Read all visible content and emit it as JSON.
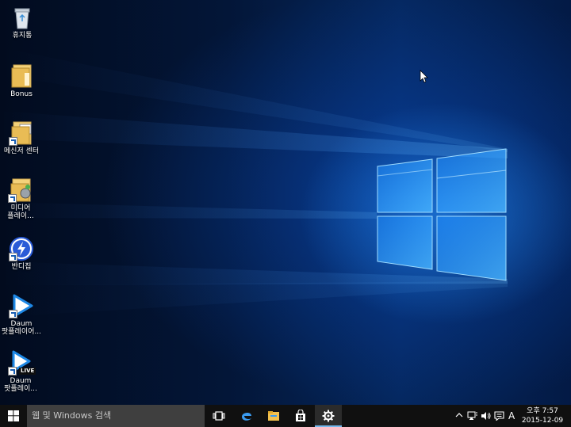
{
  "desktop": {
    "icons": [
      {
        "label": "휴지통"
      },
      {
        "label": "Bonus"
      },
      {
        "label": "메신저 센터"
      },
      {
        "label_line1": "미디어",
        "label_line2": "플레이..."
      },
      {
        "label": "반디집"
      },
      {
        "label_line1": "Daum",
        "label_line2": "팟플레이어..."
      },
      {
        "label_line1": "Daum",
        "label_line2": "팟플레이...",
        "badge": "LIVE"
      }
    ]
  },
  "taskbar": {
    "search_placeholder": "웹 및 Windows 검색",
    "tray": {
      "ime_label": "A",
      "time": "오후 7:57",
      "date": "2015-12-09"
    }
  },
  "colors": {
    "taskbar": "#101010",
    "search_box": "#3f3f3f",
    "accent": "#76b9ed"
  },
  "icons": [
    "recycle-bin-icon",
    "folder-icon",
    "windows-logo-icon",
    "task-view-icon",
    "edge-icon",
    "file-explorer-icon",
    "store-icon",
    "settings-icon",
    "chevron-up-icon",
    "network-icon",
    "volume-icon",
    "action-center-icon"
  ]
}
